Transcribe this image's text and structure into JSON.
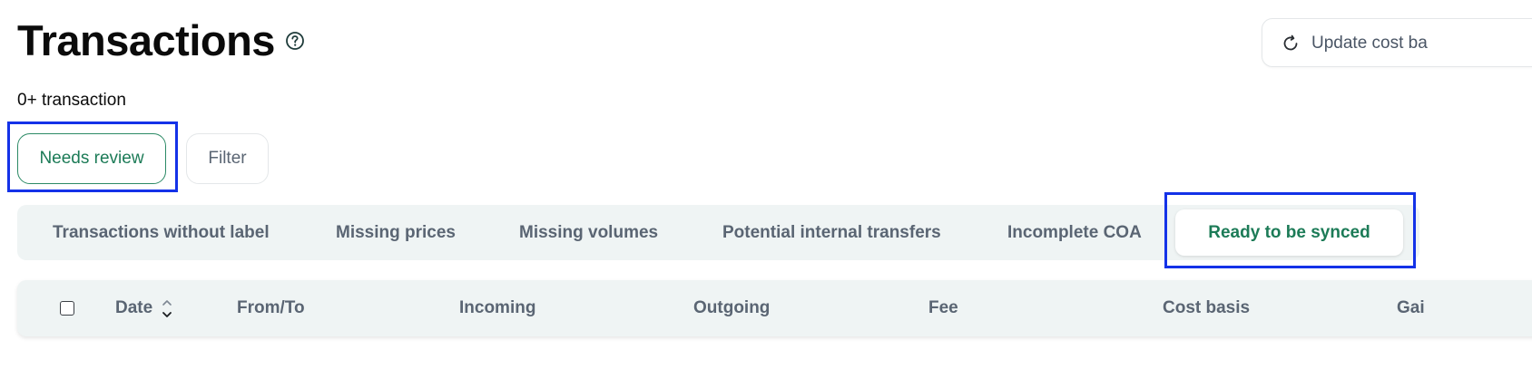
{
  "header": {
    "title": "Transactions",
    "help_icon": "help-circle-icon",
    "update_button_label": "Update cost ba",
    "update_button_icon": "refresh-icon"
  },
  "summary": {
    "count_text": "0+ transaction"
  },
  "filters": {
    "needs_review_label": "Needs review",
    "filter_label": "Filter"
  },
  "tabs": [
    {
      "label": "Transactions without label",
      "active": false
    },
    {
      "label": "Missing prices",
      "active": false
    },
    {
      "label": "Missing volumes",
      "active": false
    },
    {
      "label": "Potential internal transfers",
      "active": false
    },
    {
      "label": "Incomplete COA",
      "active": false
    },
    {
      "label": "Ready to be synced",
      "active": true
    }
  ],
  "table": {
    "columns": [
      "Date",
      "From/To",
      "Incoming",
      "Outgoing",
      "Fee",
      "Cost basis",
      "Gai"
    ],
    "sort_icon": "sort-updown-icon"
  },
  "colors": {
    "accent_green": "#1c7b57",
    "highlight_blue": "#1432e8",
    "muted_text": "#5a6573",
    "band_bg": "#eff4f4"
  }
}
